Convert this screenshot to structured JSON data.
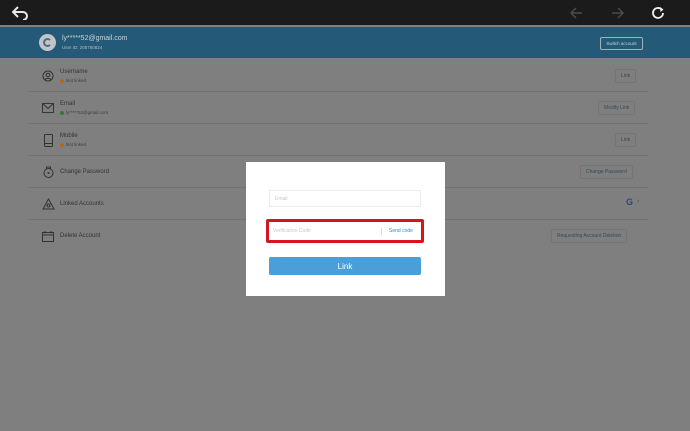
{
  "toolbar": {
    "back_icon": "back-arrow-icon",
    "prev_icon": "prev-arrow-icon",
    "next_icon": "next-arrow-icon",
    "refresh_icon": "refresh-icon"
  },
  "account": {
    "email": "ly*****52@gmail.com",
    "user_id": "User ID: 205780824",
    "switch_label": "Switch account"
  },
  "rows": [
    {
      "title": "Username",
      "status": "Not linked",
      "status_color": "orange",
      "action": "Link"
    },
    {
      "title": "Email",
      "status": "ly*****52@gmail.com",
      "status_color": "green",
      "action": "Modify Link"
    },
    {
      "title": "Mobile",
      "status": "Not linked",
      "status_color": "orange",
      "action": "Link"
    },
    {
      "title": "Change Password",
      "action": "Change Password"
    },
    {
      "title": "Linked Accounts",
      "provider": "G"
    },
    {
      "title": "Delete Account",
      "action": "Requesting Account Deletion"
    }
  ],
  "modal": {
    "email_placeholder": "Email",
    "code_placeholder": "Verification Code",
    "send_code_label": "Send code",
    "link_label": "Link"
  },
  "colors": {
    "header": "#245a78",
    "link_button": "#4a9fd8",
    "highlight_border": "#d6141c",
    "send_code": "#2d8cd6"
  }
}
